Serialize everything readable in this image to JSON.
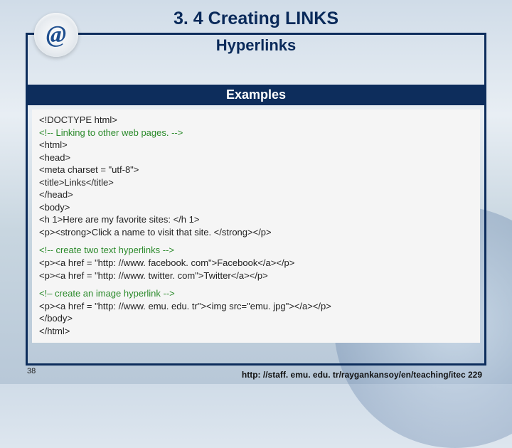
{
  "page": {
    "title": "3. 4 Creating LINKS",
    "subtitle": "Hyperlinks",
    "examples_label": "Examples",
    "page_number": "38",
    "footer_url": "http: //staff. emu. edu. tr/raygankansoy/en/teaching/itec 229",
    "at_glyph": "@"
  },
  "code": {
    "l01": "<!DOCTYPE html>",
    "l02": "<!-- Linking to other web pages. -->",
    "l03": "<html>",
    "l04": "<head>",
    "l05": "<meta charset = \"utf-8\">",
    "l06": "<title>Links</title>",
    "l07": "</head>",
    "l08": "<body>",
    "l09": "<h 1>Here are my favorite sites: </h 1>",
    "l10": "<p><strong>Click a name to visit that site. </strong></p>",
    "l11": "<!-- create two text hyperlinks -->",
    "l12": "<p><a href = \"http: //www. facebook. com\">Facebook</a></p>",
    "l13": "<p><a href = \"http: //www. twitter. com\">Twitter</a></p>",
    "l14": "<!– create an image hyperlink -->",
    "l15": "<p><a href = \"http: //www. emu. edu. tr\"><img src=\"emu. jpg\"></a></p>",
    "l16": "</body>",
    "l17": "</html>"
  }
}
